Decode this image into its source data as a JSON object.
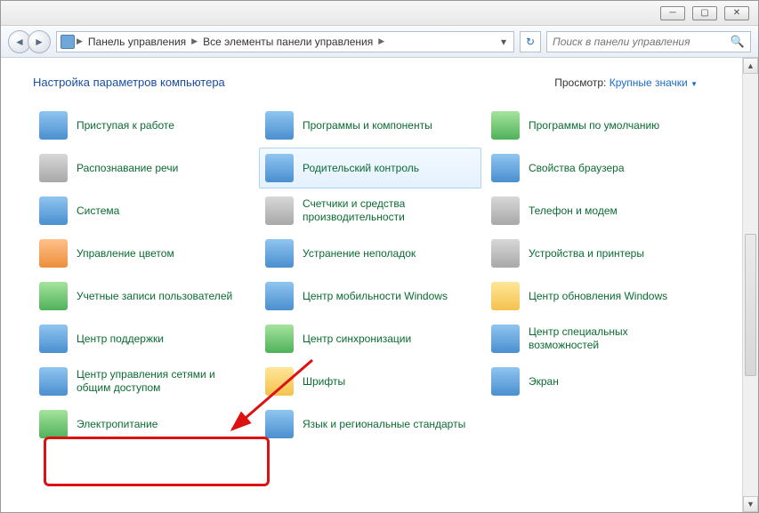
{
  "breadcrumb": {
    "items": [
      "Панель управления",
      "Все элементы панели управления"
    ]
  },
  "search": {
    "placeholder": "Поиск в панели управления"
  },
  "header": {
    "title": "Настройка параметров компьютера"
  },
  "view": {
    "label": "Просмотр:",
    "value": "Крупные значки"
  },
  "items": [
    [
      {
        "label": "Приступая к работе",
        "icon": "getting-started",
        "cls": "ic-blue"
      },
      {
        "label": "Программы и компоненты",
        "icon": "programs",
        "cls": "ic-blue"
      },
      {
        "label": "Программы по умолчанию",
        "icon": "default-programs",
        "cls": "ic-green"
      }
    ],
    [
      {
        "label": "Распознавание речи",
        "icon": "speech",
        "cls": "ic-gray"
      },
      {
        "label": "Родительский контроль",
        "icon": "parental",
        "cls": "ic-blue",
        "selected": true
      },
      {
        "label": "Свойства браузера",
        "icon": "internet-options",
        "cls": "ic-blue"
      }
    ],
    [
      {
        "label": "Система",
        "icon": "system",
        "cls": "ic-blue"
      },
      {
        "label": "Счетчики и средства производительности",
        "icon": "performance",
        "cls": "ic-gray"
      },
      {
        "label": "Телефон и модем",
        "icon": "phone",
        "cls": "ic-gray"
      }
    ],
    [
      {
        "label": "Управление цветом",
        "icon": "color-mgmt",
        "cls": "ic-orange"
      },
      {
        "label": "Устранение неполадок",
        "icon": "troubleshoot",
        "cls": "ic-blue"
      },
      {
        "label": "Устройства и принтеры",
        "icon": "devices",
        "cls": "ic-gray"
      }
    ],
    [
      {
        "label": "Учетные записи пользователей",
        "icon": "users",
        "cls": "ic-green"
      },
      {
        "label": "Центр мобильности Windows",
        "icon": "mobility",
        "cls": "ic-blue"
      },
      {
        "label": "Центр обновления Windows",
        "icon": "update",
        "cls": "ic-yellow"
      }
    ],
    [
      {
        "label": "Центр поддержки",
        "icon": "action-center",
        "cls": "ic-blue"
      },
      {
        "label": "Центр синхронизации",
        "icon": "sync",
        "cls": "ic-green"
      },
      {
        "label": "Центр специальных возможностей",
        "icon": "ease-access",
        "cls": "ic-blue"
      }
    ],
    [
      {
        "label": "Центр управления сетями и общим доступом",
        "icon": "network",
        "cls": "ic-blue",
        "highlighted": true
      },
      {
        "label": "Шрифты",
        "icon": "fonts",
        "cls": "ic-yellow"
      },
      {
        "label": "Экран",
        "icon": "display",
        "cls": "ic-blue"
      }
    ],
    [
      {
        "label": "Электропитание",
        "icon": "power",
        "cls": "ic-green"
      },
      {
        "label": "Язык и региональные стандарты",
        "icon": "region",
        "cls": "ic-blue"
      },
      {
        "label": "",
        "icon": "",
        "cls": "",
        "empty": true
      }
    ]
  ]
}
